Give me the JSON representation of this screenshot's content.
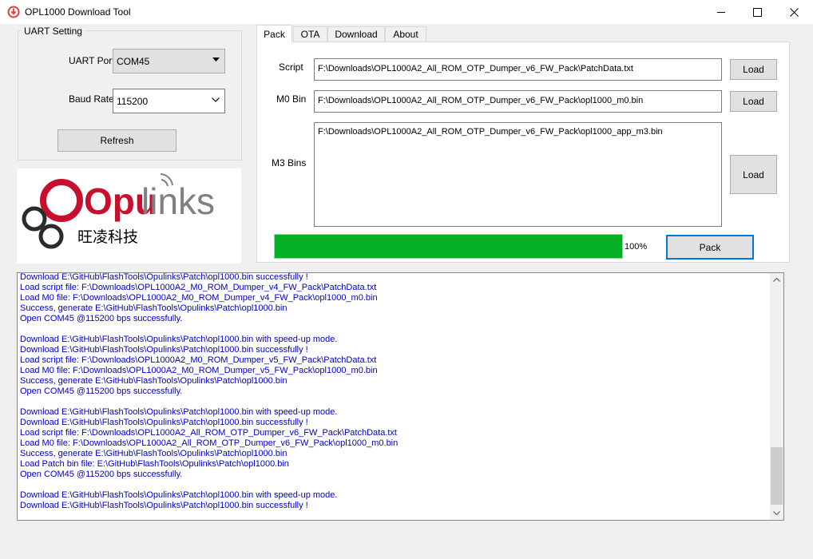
{
  "window": {
    "title": "OPL1000 Download Tool",
    "icon": "download-arrow-icon",
    "controls": [
      "minimize-icon",
      "maximize-icon",
      "close-icon"
    ]
  },
  "uart": {
    "group_label": "UART Setting",
    "port_label": "UART Port",
    "port_value": "COM45",
    "baud_label": "Baud Rate",
    "baud_value": "115200",
    "refresh_label": "Refresh"
  },
  "logo": {
    "brand_red": "Opu",
    "brand_gray": "links",
    "chinese": "旺凌科技",
    "colors": {
      "red": "#c8102e",
      "gray": "#808080",
      "dark": "#2b2b2b"
    }
  },
  "tabs": [
    {
      "label": "Pack",
      "active": true
    },
    {
      "label": "OTA",
      "active": false
    },
    {
      "label": "Download",
      "active": false
    },
    {
      "label": "About",
      "active": false
    }
  ],
  "pack": {
    "script_label": "Script",
    "script_value": "F:\\Downloads\\OPL1000A2_All_ROM_OTP_Dumper_v6_FW_Pack\\PatchData.txt",
    "m0_label": "M0 Bin",
    "m0_value": "F:\\Downloads\\OPL1000A2_All_ROM_OTP_Dumper_v6_FW_Pack\\opl1000_m0.bin",
    "m3_label": "M3 Bins",
    "m3_value": "F:\\Downloads\\OPL1000A2_All_ROM_OTP_Dumper_v6_FW_Pack\\opl1000_app_m3.bin",
    "load_label": "Load",
    "progress_fraction": 1.0,
    "progress_text": "100%",
    "pack_label": "Pack"
  },
  "log": {
    "lines": [
      "Download E:\\GitHub\\FlashTools\\Opulinks\\Patch\\opl1000.bin successfully !",
      "Load script file: F:\\Downloads\\OPL1000A2_M0_ROM_Dumper_v4_FW_Pack\\PatchData.txt",
      "Load M0 file: F:\\Downloads\\OPL1000A2_M0_ROM_Dumper_v4_FW_Pack\\opl1000_m0.bin",
      "Success, generate E:\\GitHub\\FlashTools\\Opulinks\\Patch\\opl1000.bin",
      "Open COM45 @115200 bps successfully.",
      "",
      "Download E:\\GitHub\\FlashTools\\Opulinks\\Patch\\opl1000.bin with speed-up mode.",
      "Download E:\\GitHub\\FlashTools\\Opulinks\\Patch\\opl1000.bin successfully !",
      "Load script file: F:\\Downloads\\OPL1000A2_M0_ROM_Dumper_v5_FW_Pack\\PatchData.txt",
      "Load M0 file: F:\\Downloads\\OPL1000A2_M0_ROM_Dumper_v5_FW_Pack\\opl1000_m0.bin",
      "Success, generate E:\\GitHub\\FlashTools\\Opulinks\\Patch\\opl1000.bin",
      "Open COM45 @115200 bps successfully.",
      "",
      "Download E:\\GitHub\\FlashTools\\Opulinks\\Patch\\opl1000.bin with speed-up mode.",
      "Download E:\\GitHub\\FlashTools\\Opulinks\\Patch\\opl1000.bin successfully !",
      "Load script file: F:\\Downloads\\OPL1000A2_All_ROM_OTP_Dumper_v6_FW_Pack\\PatchData.txt",
      "Load M0 file: F:\\Downloads\\OPL1000A2_All_ROM_OTP_Dumper_v6_FW_Pack\\opl1000_m0.bin",
      "Success, generate E:\\GitHub\\FlashTools\\Opulinks\\Patch\\opl1000.bin",
      "Load Patch bin file: E:\\GitHub\\FlashTools\\Opulinks\\Patch\\opl1000.bin",
      "Open COM45 @115200 bps successfully.",
      "",
      "Download E:\\GitHub\\FlashTools\\Opulinks\\Patch\\opl1000.bin with speed-up mode.",
      "Download E:\\GitHub\\FlashTools\\Opulinks\\Patch\\opl1000.bin successfully !"
    ],
    "color": "#0000c8"
  }
}
